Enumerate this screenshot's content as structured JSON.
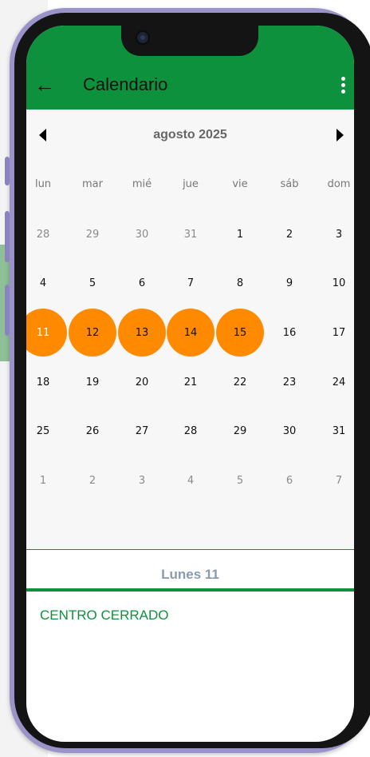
{
  "appbar": {
    "title": "Calendario",
    "back_icon": "arrow-left-icon",
    "menu_icon": "more-vert-icon"
  },
  "calendar": {
    "month_label": "agosto 2025",
    "weekdays": [
      "lun",
      "mar",
      "mié",
      "jue",
      "vie",
      "sáb",
      "dom"
    ],
    "weeks": [
      [
        {
          "d": "28",
          "other": true
        },
        {
          "d": "29",
          "other": true
        },
        {
          "d": "30",
          "other": true
        },
        {
          "d": "31",
          "other": true
        },
        {
          "d": "1"
        },
        {
          "d": "2"
        },
        {
          "d": "3"
        }
      ],
      [
        {
          "d": "4"
        },
        {
          "d": "5"
        },
        {
          "d": "6"
        },
        {
          "d": "7"
        },
        {
          "d": "8"
        },
        {
          "d": "9"
        },
        {
          "d": "10"
        }
      ],
      [
        {
          "d": "11",
          "sel": true,
          "first": true
        },
        {
          "d": "12",
          "sel": true
        },
        {
          "d": "13",
          "sel": true
        },
        {
          "d": "14",
          "sel": true
        },
        {
          "d": "15",
          "sel": true
        },
        {
          "d": "16"
        },
        {
          "d": "17"
        }
      ],
      [
        {
          "d": "18"
        },
        {
          "d": "19"
        },
        {
          "d": "20"
        },
        {
          "d": "21"
        },
        {
          "d": "22"
        },
        {
          "d": "23"
        },
        {
          "d": "24"
        }
      ],
      [
        {
          "d": "25"
        },
        {
          "d": "26"
        },
        {
          "d": "27"
        },
        {
          "d": "28"
        },
        {
          "d": "29"
        },
        {
          "d": "30"
        },
        {
          "d": "31"
        }
      ],
      [
        {
          "d": "1",
          "other": true
        },
        {
          "d": "2",
          "other": true
        },
        {
          "d": "3",
          "other": true
        },
        {
          "d": "4",
          "other": true
        },
        {
          "d": "5",
          "other": true
        },
        {
          "d": "6",
          "other": true
        },
        {
          "d": "7",
          "other": true
        }
      ]
    ],
    "prev_icon": "triangle-left-icon",
    "next_icon": "triangle-right-icon"
  },
  "selected_day_label": "Lunes  11",
  "event_text": "CENTRO CERRADO",
  "colors": {
    "brand_green": "#0e913d",
    "selection_orange": "#ff8a00",
    "frame_purple": "#9a93c9"
  }
}
